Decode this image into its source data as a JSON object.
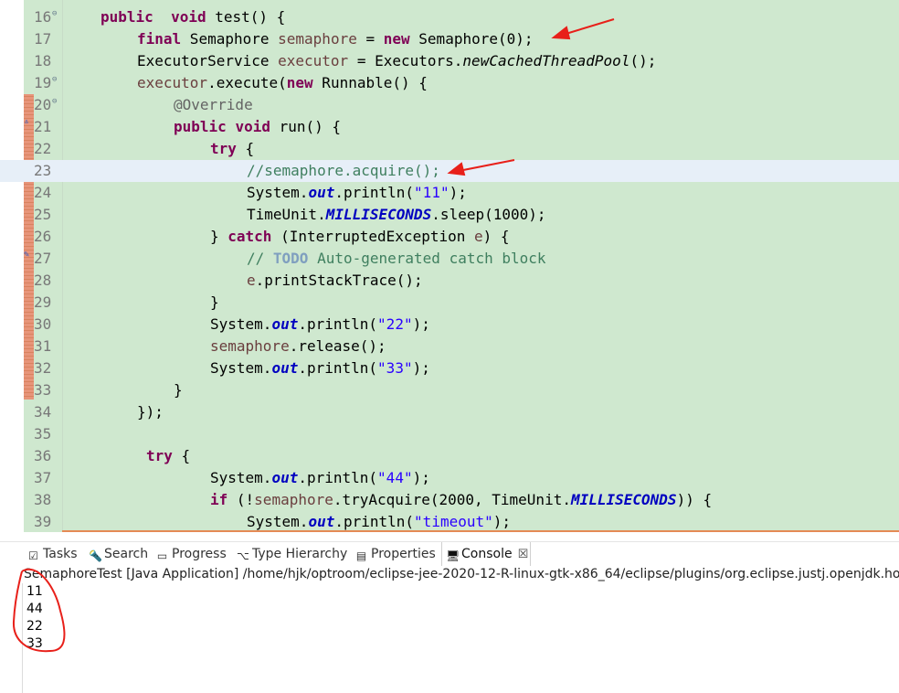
{
  "editor": {
    "lines": [
      {
        "n": "16",
        "tokens": [
          [
            "kw",
            "public"
          ],
          [
            "",
            "  "
          ],
          [
            "kw",
            "void"
          ],
          [
            "",
            " test() {"
          ]
        ]
      },
      {
        "n": "17",
        "tokens": [
          [
            "kw",
            "final"
          ],
          [
            "",
            " Semaphore "
          ],
          [
            "fld",
            "semaphore"
          ],
          [
            "",
            " = "
          ],
          [
            "kw",
            "new"
          ],
          [
            "",
            " Semaphore(0);"
          ]
        ]
      },
      {
        "n": "18",
        "tokens": [
          [
            "",
            "ExecutorService "
          ],
          [
            "fld",
            "executor"
          ],
          [
            "",
            " = Executors."
          ],
          [
            "st-i",
            "newCachedThreadPool"
          ],
          [
            "",
            "();"
          ]
        ]
      },
      {
        "n": "19",
        "tokens": [
          [
            "fld",
            "executor"
          ],
          [
            "",
            ".execute("
          ],
          [
            "kw",
            "new"
          ],
          [
            "",
            " Runnable() {"
          ]
        ]
      },
      {
        "n": "20",
        "tokens": [
          [
            "ann",
            "@Override"
          ]
        ]
      },
      {
        "n": "21",
        "tokens": [
          [
            "kw",
            "public"
          ],
          [
            "",
            " "
          ],
          [
            "kw",
            "void"
          ],
          [
            "",
            " run() {"
          ]
        ]
      },
      {
        "n": "22",
        "tokens": [
          [
            "kw",
            "try"
          ],
          [
            "",
            " {"
          ]
        ]
      },
      {
        "n": "23",
        "tokens": [
          [
            "cmt",
            "//semaphore.acquire();"
          ]
        ]
      },
      {
        "n": "24",
        "tokens": [
          [
            "",
            "System."
          ],
          [
            "st-fld",
            "out"
          ],
          [
            "",
            ".println("
          ],
          [
            "str",
            "\"11\""
          ],
          [
            "",
            ");"
          ]
        ]
      },
      {
        "n": "25",
        "tokens": [
          [
            "",
            "TimeUnit."
          ],
          [
            "st-fld",
            "MILLISECONDS"
          ],
          [
            "",
            ".sleep(1000);"
          ]
        ]
      },
      {
        "n": "26",
        "tokens": [
          [
            "",
            "} "
          ],
          [
            "kw",
            "catch"
          ],
          [
            "",
            " (InterruptedException "
          ],
          [
            "fld",
            "e"
          ],
          [
            "",
            ") {"
          ]
        ]
      },
      {
        "n": "27",
        "tokens": [
          [
            "cmt",
            "// "
          ],
          [
            "todo",
            "TODO"
          ],
          [
            "cmt",
            " Auto-generated catch block"
          ]
        ]
      },
      {
        "n": "28",
        "tokens": [
          [
            "fld",
            "e"
          ],
          [
            "",
            ".printStackTrace();"
          ]
        ]
      },
      {
        "n": "29",
        "tokens": [
          [
            "",
            "}"
          ]
        ]
      },
      {
        "n": "30",
        "tokens": [
          [
            "",
            "System."
          ],
          [
            "st-fld",
            "out"
          ],
          [
            "",
            ".println("
          ],
          [
            "str",
            "\"22\""
          ],
          [
            "",
            ");"
          ]
        ]
      },
      {
        "n": "31",
        "tokens": [
          [
            "fld",
            "semaphore"
          ],
          [
            "",
            ".release();"
          ]
        ]
      },
      {
        "n": "32",
        "tokens": [
          [
            "",
            "System."
          ],
          [
            "st-fld",
            "out"
          ],
          [
            "",
            ".println("
          ],
          [
            "str",
            "\"33\""
          ],
          [
            "",
            ");"
          ]
        ]
      },
      {
        "n": "33",
        "tokens": [
          [
            "",
            "}"
          ]
        ]
      },
      {
        "n": "34",
        "tokens": [
          [
            "",
            "});"
          ]
        ]
      },
      {
        "n": "35",
        "tokens": []
      },
      {
        "n": "36",
        "tokens": [
          [
            "kw",
            "try"
          ],
          [
            "",
            " {"
          ]
        ]
      },
      {
        "n": "37",
        "tokens": [
          [
            "",
            "System."
          ],
          [
            "st-fld",
            "out"
          ],
          [
            "",
            ".println("
          ],
          [
            "str",
            "\"44\""
          ],
          [
            "",
            ");"
          ]
        ]
      },
      {
        "n": "38",
        "tokens": [
          [
            "kw",
            "if"
          ],
          [
            "",
            " (!"
          ],
          [
            "fld",
            "semaphore"
          ],
          [
            "",
            ".tryAcquire(2000, TimeUnit."
          ],
          [
            "st-fld",
            "MILLISECONDS"
          ],
          [
            "",
            ")) {"
          ]
        ]
      },
      {
        "n": "39",
        "tokens": [
          [
            "",
            "System."
          ],
          [
            "st-fld",
            "out"
          ],
          [
            "",
            ".println("
          ],
          [
            "str",
            "\"timeout\""
          ],
          [
            "",
            ");"
          ]
        ]
      }
    ]
  },
  "tabs": [
    {
      "label": "Tasks",
      "icon": "tasks-icon",
      "glyph": "☑"
    },
    {
      "label": "Search",
      "icon": "search-icon",
      "glyph": "🔦"
    },
    {
      "label": "Progress",
      "icon": "progress-icon",
      "glyph": "▭"
    },
    {
      "label": "Type Hierarchy",
      "icon": "type-hierarchy-icon",
      "glyph": "⌥"
    },
    {
      "label": "Properties",
      "icon": "properties-icon",
      "glyph": "▤"
    },
    {
      "label": "Console",
      "icon": "console-icon",
      "glyph": "🖥",
      "active": true,
      "close": "☒"
    }
  ],
  "console": {
    "header": "SemaphoreTest [Java Application] /home/hjk/optroom/eclipse-jee-2020-12-R-linux-gtk-x86_64/eclipse/plugins/org.eclipse.justj.openjdk.hotspo",
    "output": [
      "11",
      "44",
      "22",
      "33"
    ]
  },
  "colors": {
    "editor_bg": "#cfe8cf",
    "current_line": "#e7eff8",
    "keyword": "#7f0055",
    "string": "#2a00ff",
    "comment": "#3f7f5f",
    "annotation_red": "#e8201a"
  }
}
